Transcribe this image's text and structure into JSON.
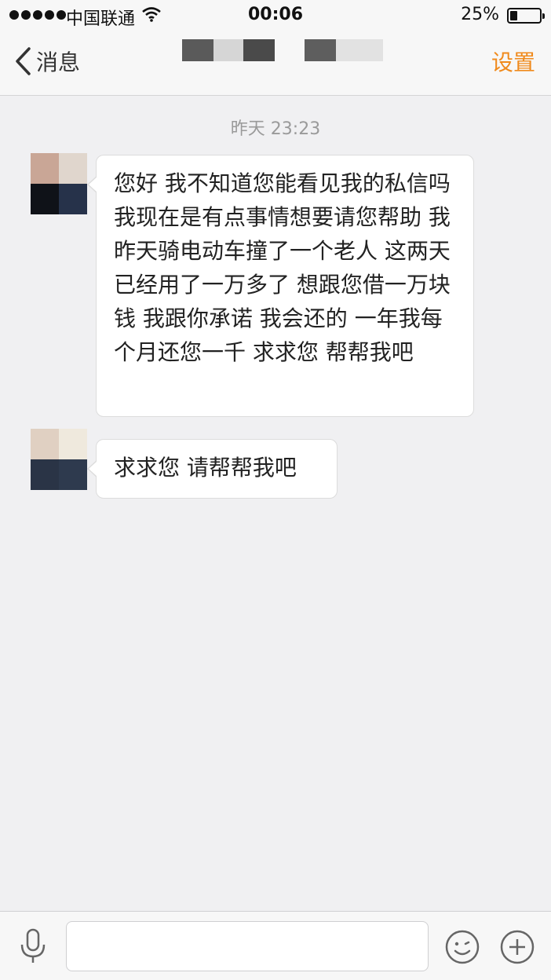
{
  "status_bar": {
    "carrier": "中国联通",
    "time": "00:06",
    "battery_percent_text": "25%",
    "battery_level": 0.25
  },
  "nav": {
    "back_label": "消息",
    "settings_label": "设置",
    "accent_color": "#f08a1c"
  },
  "chat": {
    "timestamp": "昨天 23:23",
    "messages": [
      {
        "text": "您好 我不知道您能看见我的私信吗 我现在是有点事情想要请您帮助 我昨天骑电动车撞了一个老人 这两天已经用了一万多了 想跟您借一万块钱 我跟你承诺 我会还的 一年我每个月还您一千 求求您 帮帮我吧"
      },
      {
        "text": "求求您 请帮帮我吧"
      }
    ]
  },
  "input_bar": {
    "text_value": "",
    "icons": [
      "microphone-icon",
      "emoji-icon",
      "plus-icon"
    ]
  }
}
